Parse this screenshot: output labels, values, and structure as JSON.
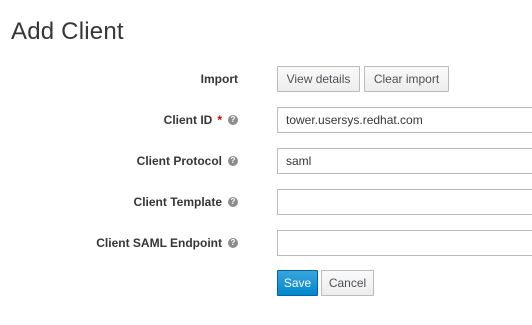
{
  "page": {
    "title": "Add Client"
  },
  "form": {
    "import": {
      "label": "Import",
      "view_details": "View details",
      "clear_import": "Clear import"
    },
    "client_id": {
      "label": "Client ID",
      "required_mark": "*",
      "value": "tower.usersys.redhat.com"
    },
    "client_protocol": {
      "label": "Client Protocol",
      "value": "saml"
    },
    "client_template": {
      "label": "Client Template",
      "value": ""
    },
    "client_saml_endpoint": {
      "label": "Client SAML Endpoint",
      "value": ""
    },
    "help_glyph": "?"
  },
  "actions": {
    "save": "Save",
    "cancel": "Cancel"
  },
  "colors": {
    "primary": "#0088ce",
    "required": "#cc0000"
  }
}
